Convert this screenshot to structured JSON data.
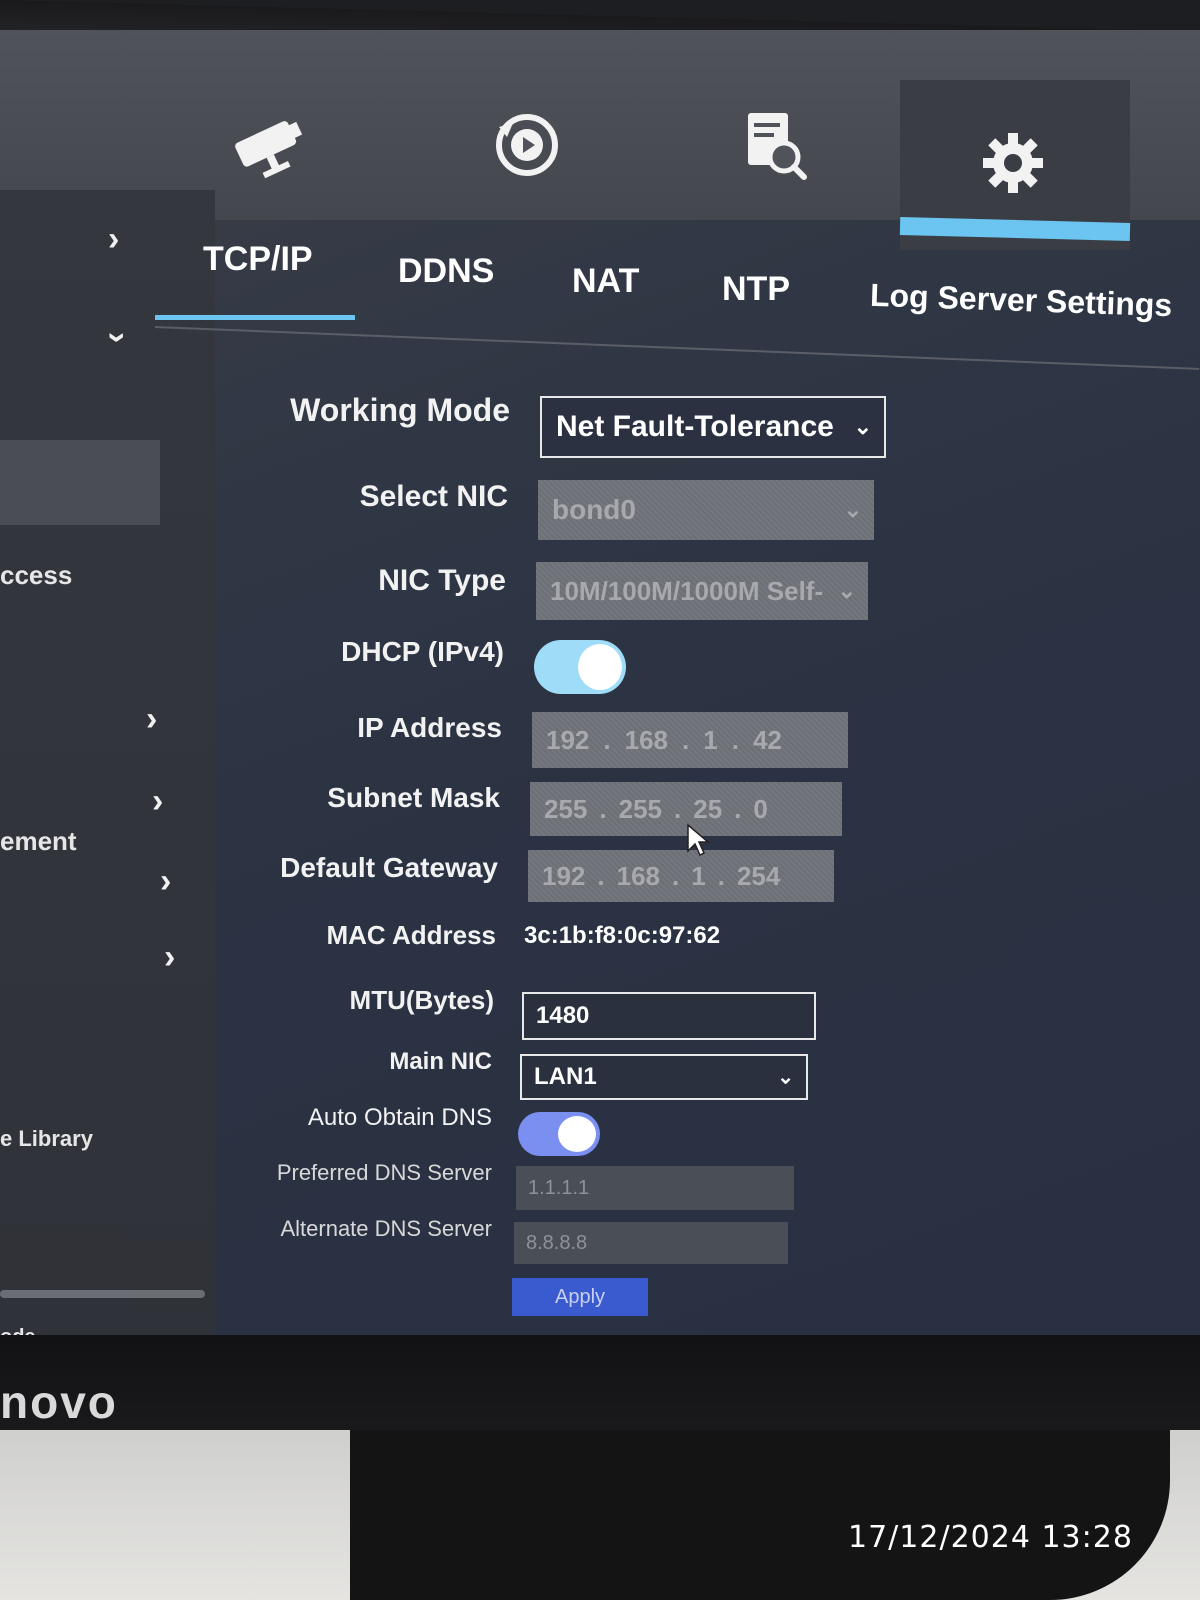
{
  "top_nav": {
    "icons": [
      "camera-icon",
      "playback-icon",
      "search-icon",
      "settings-icon"
    ],
    "accent_color": "#6cc4f1"
  },
  "sidebar": {
    "items": [
      {
        "label": "ccess"
      },
      {
        "label": "ement"
      },
      {
        "label": "e Library"
      },
      {
        "label": "ode"
      }
    ]
  },
  "tabs": [
    {
      "label": "TCP/IP",
      "active": true
    },
    {
      "label": "DDNS"
    },
    {
      "label": "NAT"
    },
    {
      "label": "NTP"
    },
    {
      "label": "Log Server Settings"
    }
  ],
  "form": {
    "working_mode": {
      "label": "Working Mode",
      "value": "Net Fault-Tolerance"
    },
    "select_nic": {
      "label": "Select NIC",
      "value": "bond0"
    },
    "nic_type": {
      "label": "NIC Type",
      "value": "10M/100M/1000M Self-"
    },
    "dhcp": {
      "label": "DHCP (IPv4)",
      "enabled": true
    },
    "ip_address": {
      "label": "IP Address",
      "octets": [
        "192",
        "168",
        "1",
        "42"
      ]
    },
    "subnet_mask": {
      "label": "Subnet Mask",
      "octets": [
        "255",
        "255",
        "25",
        "0"
      ]
    },
    "default_gateway": {
      "label": "Default Gateway",
      "octets": [
        "192",
        "168",
        "1",
        "254"
      ]
    },
    "mac_address": {
      "label": "MAC Address",
      "value": "3c:1b:f8:0c:97:62"
    },
    "mtu": {
      "label": "MTU(Bytes)",
      "value": "1480"
    },
    "main_nic": {
      "label": "Main NIC",
      "value": "LAN1"
    },
    "auto_dns": {
      "label": "Auto Obtain DNS",
      "enabled": true
    },
    "preferred_dns": {
      "label": "Preferred DNS Server",
      "value": "1.1.1.1"
    },
    "alternate_dns": {
      "label": "Alternate DNS Server",
      "value": "8.8.8.8"
    },
    "apply_label": "Apply"
  },
  "monitor": {
    "brand": "novo"
  },
  "photo": {
    "timestamp": "17/12/2024  13:28"
  }
}
